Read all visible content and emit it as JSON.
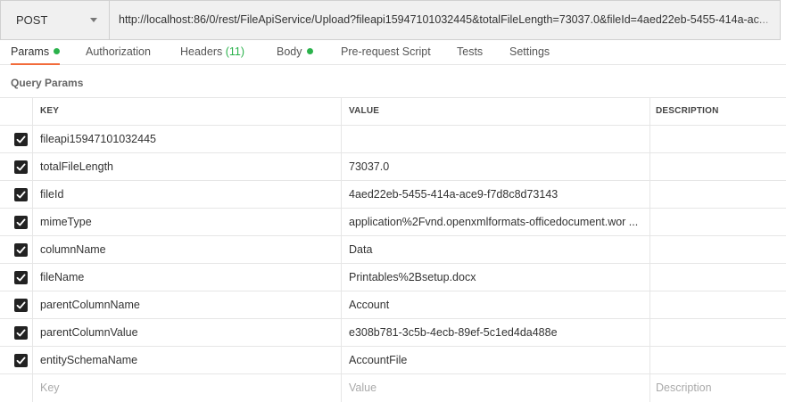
{
  "request": {
    "method": "POST",
    "url": "http://localhost:86/0/rest/FileApiService/Upload?fileapi15947101032445&totalFileLength=73037.0&fileId=4aed22eb-5455-414a-ac..."
  },
  "tabs": {
    "params": "Params",
    "authorization": "Authorization",
    "headers": "Headers",
    "headers_count": "(11)",
    "body": "Body",
    "prerequest": "Pre-request Script",
    "tests": "Tests",
    "settings": "Settings"
  },
  "query_params": {
    "title": "Query Params",
    "columns": {
      "key": "KEY",
      "value": "VALUE",
      "description": "DESCRIPTION"
    },
    "rows": [
      {
        "key": "fileapi15947101032445",
        "value": ""
      },
      {
        "key": "totalFileLength",
        "value": "73037.0"
      },
      {
        "key": "fileId",
        "value": "4aed22eb-5455-414a-ace9-f7d8c8d73143"
      },
      {
        "key": "mimeType",
        "value": "application%2Fvnd.openxmlformats-officedocument.wor ..."
      },
      {
        "key": "columnName",
        "value": "Data"
      },
      {
        "key": "fileName",
        "value": "Printables%2Bsetup.docx"
      },
      {
        "key": "parentColumnName",
        "value": "Account"
      },
      {
        "key": "parentColumnValue",
        "value": "e308b781-3c5b-4ecb-89ef-5c1ed4da488e"
      },
      {
        "key": "entitySchemaName",
        "value": "AccountFile"
      }
    ],
    "placeholders": {
      "key": "Key",
      "value": "Value",
      "description": "Description"
    }
  },
  "colors": {
    "accent": "#f26b3a",
    "status_green": "#2bb24c",
    "field_bg": "#f0f0f0"
  }
}
